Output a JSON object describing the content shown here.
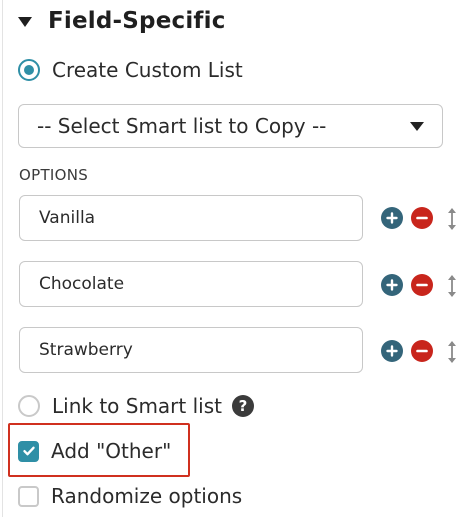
{
  "section": {
    "title": "Field-Specific",
    "icon": "caret-down-icon"
  },
  "create_custom_list": {
    "label": "Create Custom List",
    "selected": true
  },
  "smart_list_select": {
    "selected_value": "-- Select Smart list to Copy --"
  },
  "options": {
    "header": "OPTIONS",
    "items": [
      {
        "value": "Vanilla"
      },
      {
        "value": "Chocolate"
      },
      {
        "value": "Strawberry"
      }
    ]
  },
  "link_smart_list": {
    "label": "Link to Smart list",
    "selected": false,
    "help_icon": "?"
  },
  "add_other": {
    "label": "Add \"Other\"",
    "checked": true
  },
  "randomize": {
    "label": "Randomize options",
    "checked": false
  },
  "colors": {
    "accent": "#2f8fa6",
    "add_button": "#34657a",
    "remove_button": "#c8251c",
    "highlight": "#d0301f"
  }
}
